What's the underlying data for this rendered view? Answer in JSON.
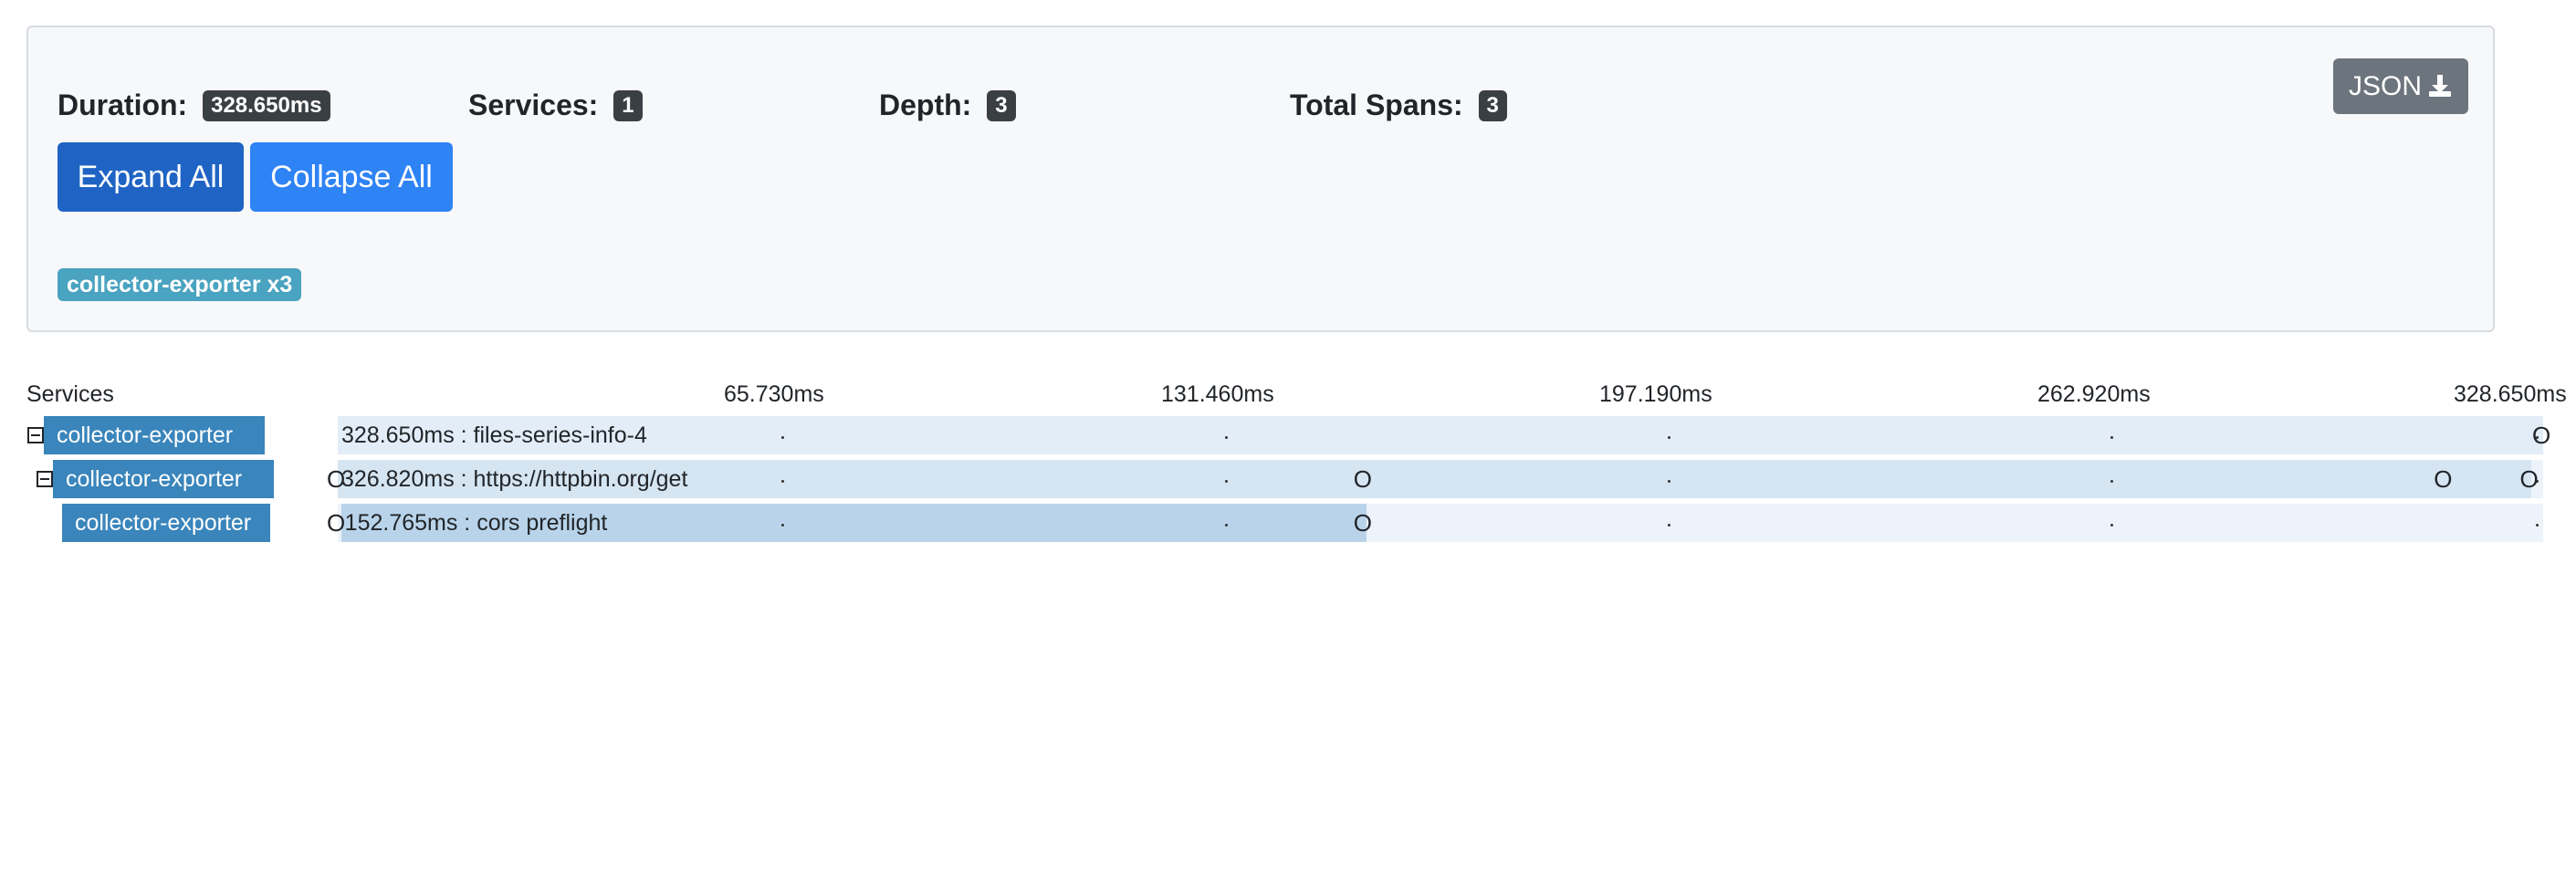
{
  "summary": {
    "duration_label": "Duration:",
    "duration_value": "328.650ms",
    "services_label": "Services:",
    "services_value": "1",
    "depth_label": "Depth:",
    "depth_value": "3",
    "spans_label": "Total Spans:",
    "spans_value": "3",
    "json_label": "JSON",
    "expand_label": "Expand All",
    "collapse_label": "Collapse All",
    "service_chip": "collector-exporter x3"
  },
  "timeline": {
    "services_header": "Services",
    "ticks": [
      "65.730ms",
      "131.460ms",
      "197.190ms",
      "262.920ms",
      "328.650ms"
    ],
    "spans": [
      {
        "service": "collector-exporter",
        "label": "328.650ms : files-series-info-4",
        "start_ms": 0,
        "duration_ms": 328.65,
        "has_toggle": true,
        "event_mark": "O",
        "event_ms": [
          328.65
        ]
      },
      {
        "service": "collector-exporter",
        "label": "326.820ms : https://httpbin.org/get",
        "start_ms": 0,
        "duration_ms": 326.82,
        "has_toggle": true,
        "event_mark": "O",
        "event_ms": [
          0,
          153,
          314,
          326.82
        ]
      },
      {
        "service": "collector-exporter",
        "label": "152.765ms : cors preflight",
        "start_ms": 0.5,
        "duration_ms": 152.765,
        "has_toggle": false,
        "event_mark": "O",
        "event_ms": [
          0,
          153
        ]
      }
    ]
  },
  "colors": {
    "row_bg": "#edf3fa",
    "span_bars": [
      "#e3edf7",
      "#d5e5f2",
      "#b9d4ea"
    ],
    "service_box": "#3a85bb",
    "badge": "#3a3f44",
    "chip": "#4aa3c0"
  }
}
